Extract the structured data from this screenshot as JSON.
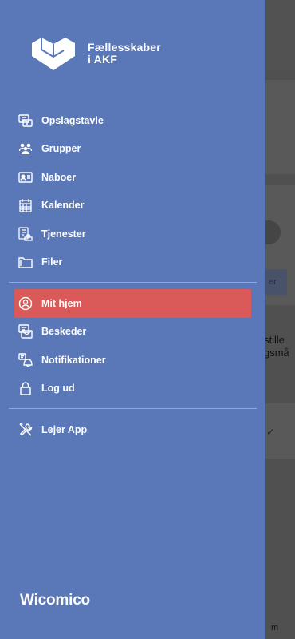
{
  "brand_title_line1": "Fællesskaber",
  "brand_title_line2": "i AKF",
  "menu_primary": [
    {
      "label": "Opslagstavle",
      "icon": "board-icon"
    },
    {
      "label": "Grupper",
      "icon": "group-icon"
    },
    {
      "label": "Naboer",
      "icon": "contact-card-icon"
    },
    {
      "label": "Kalender",
      "icon": "calendar-icon"
    },
    {
      "label": "Tjenester",
      "icon": "services-icon"
    },
    {
      "label": "Filer",
      "icon": "folder-icon"
    }
  ],
  "menu_secondary": [
    {
      "label": "Mit hjem",
      "icon": "user-circle-icon",
      "active": true
    },
    {
      "label": "Beskeder",
      "icon": "messages-icon"
    },
    {
      "label": "Notifikationer",
      "icon": "bell-icon"
    },
    {
      "label": "Log ud",
      "icon": "lock-icon"
    }
  ],
  "menu_tertiary": [
    {
      "label": "Lejer App",
      "icon": "tools-icon"
    }
  ],
  "footer_brand": "Wicomico",
  "background_fragments": {
    "button_text": "er",
    "text_line1": "stille",
    "text_line2": "gsmå",
    "bottom_text": "m"
  },
  "colors": {
    "drawer": "#5a78b8",
    "active_item": "#d95a58",
    "text": "#ffffff"
  }
}
